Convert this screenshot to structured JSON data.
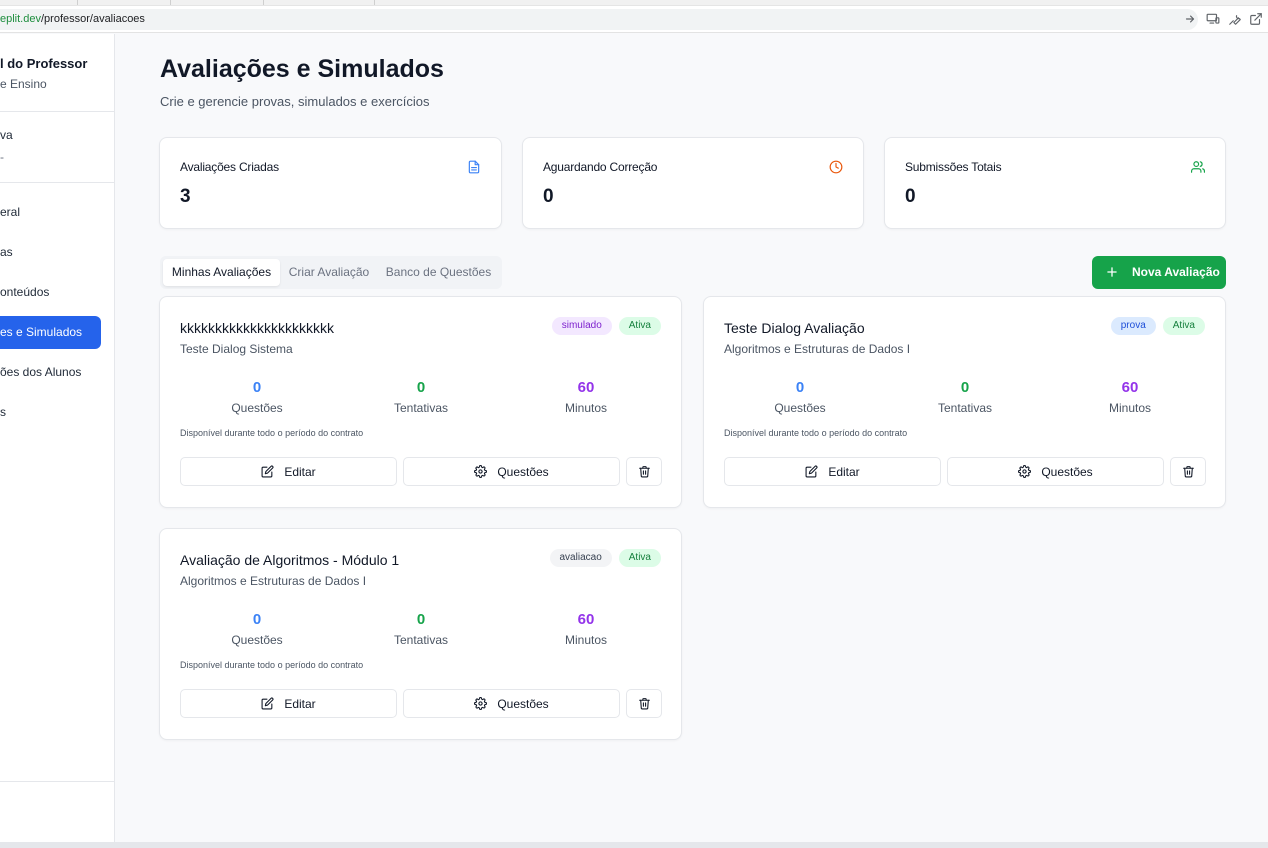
{
  "browser": {
    "url_host": "eplit.dev",
    "url_path": "/professor/avaliacoes"
  },
  "sidebar": {
    "title": "l do Professor",
    "subtitle": "e Ensino",
    "section_item": "va",
    "section_item_sub": "-",
    "items": [
      {
        "label": "eral"
      },
      {
        "label": "as"
      },
      {
        "label": "onteúdos"
      },
      {
        "label": "es e Simulados"
      },
      {
        "label": "ões dos Alunos"
      },
      {
        "label": "s"
      }
    ]
  },
  "header": {
    "title": "Avaliações e Simulados",
    "subtitle": "Crie e gerencie provas, simulados e exercícios"
  },
  "stats": [
    {
      "label": "Avaliações Criadas",
      "value": "3",
      "icon": "document-icon",
      "color": "#3b82f6"
    },
    {
      "label": "Aguardando Correção",
      "value": "0",
      "icon": "clock-icon",
      "color": "#ea580c"
    },
    {
      "label": "Submissões Totais",
      "value": "0",
      "icon": "users-icon",
      "color": "#16a34a"
    }
  ],
  "tabs": [
    {
      "label": "Minhas Avaliações",
      "active": true
    },
    {
      "label": "Criar Avaliação",
      "active": false
    },
    {
      "label": "Banco de Questões",
      "active": false
    }
  ],
  "new_button": {
    "label": "Nova Avaliação",
    "color": "#16a34a"
  },
  "cards": [
    {
      "title": "kkkkkkkkkkkkkkkkkkkkkk",
      "subtitle": "Teste Dialog Sistema",
      "type_badge": "simulado",
      "status_badge": "Ativa",
      "metrics": [
        {
          "value": "0",
          "label": "Questões"
        },
        {
          "value": "0",
          "label": "Tentativas"
        },
        {
          "value": "60",
          "label": "Minutos"
        }
      ],
      "availability": "Disponível durante todo o período do contrato",
      "edit_label": "Editar",
      "questions_label": "Questões"
    },
    {
      "title": "Teste Dialog Avaliação",
      "subtitle": "Algoritmos e Estruturas de Dados I",
      "type_badge": "prova",
      "status_badge": "Ativa",
      "metrics": [
        {
          "value": "0",
          "label": "Questões"
        },
        {
          "value": "0",
          "label": "Tentativas"
        },
        {
          "value": "60",
          "label": "Minutos"
        }
      ],
      "availability": "Disponível durante todo o período do contrato",
      "edit_label": "Editar",
      "questions_label": "Questões"
    },
    {
      "title": "Avaliação de Algoritmos - Módulo 1",
      "subtitle": "Algoritmos e Estruturas de Dados I",
      "type_badge": "avaliacao",
      "status_badge": "Ativa",
      "metrics": [
        {
          "value": "0",
          "label": "Questões"
        },
        {
          "value": "0",
          "label": "Tentativas"
        },
        {
          "value": "60",
          "label": "Minutos"
        }
      ],
      "availability": "Disponível durante todo o período do contrato",
      "edit_label": "Editar",
      "questions_label": "Questões"
    }
  ],
  "colors": {
    "accent_blue": "#2563eb",
    "metric_blue": "#3b82f6",
    "metric_green": "#16a34a",
    "metric_purple": "#9333ea"
  }
}
